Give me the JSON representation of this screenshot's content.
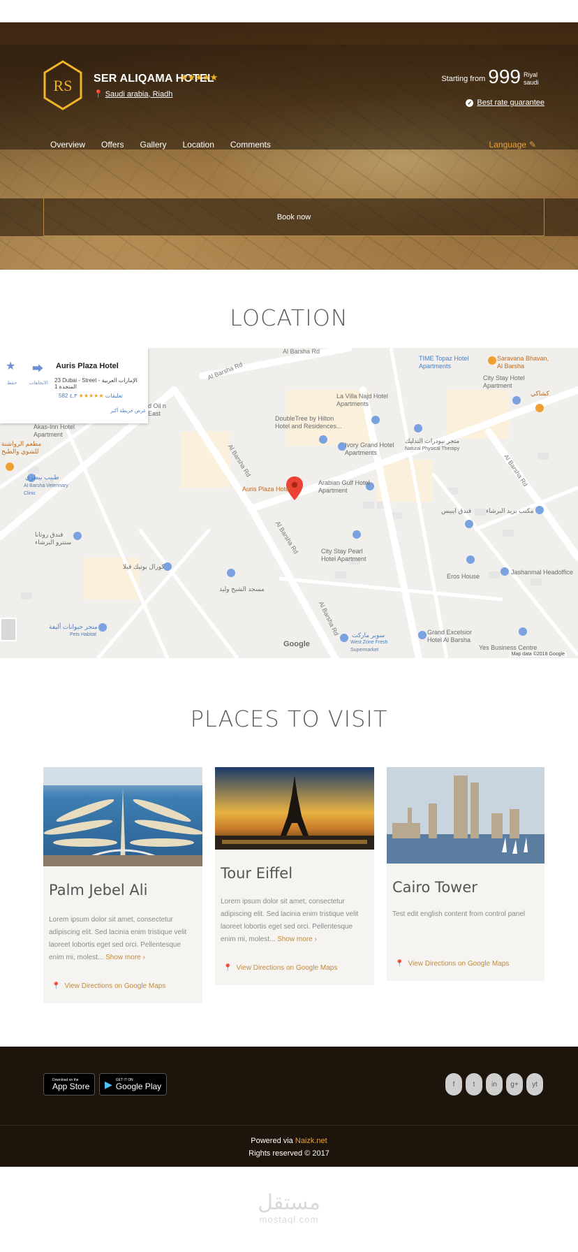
{
  "hero": {
    "hotel_name": "SER ALIQAMA HOTEL",
    "stars": "★★★★★",
    "location": "Saudi arabia, Riadh",
    "starting_label": "Starting from",
    "price": "999",
    "currency": "Riyal saudi",
    "guarantee": "Best rate guarantee",
    "nav": [
      "Overview",
      "Offers",
      "Gallery",
      "Location",
      "Comments"
    ],
    "language": "Language",
    "book": "Book now",
    "logo_text": "RS"
  },
  "location": {
    "title": "LOCATION",
    "card": {
      "name": "Auris Plaza Hotel",
      "address": "23 Dubai - Street - الإمارات العربية المتحدة 1",
      "rating": "٤,٣",
      "stars": "★★★★★",
      "reviews": "582 تعليقات",
      "bigger_map": "عرض خريطة أكبر",
      "save_label": "حفظ",
      "directions_label": "الاتجاهات"
    },
    "labels": {
      "barsha1": "Al Barsha Rd",
      "barsha2": "Al Barsha Rd",
      "barsha3": "Al Barsha Rd",
      "barsha4": "Al Barsha Rd",
      "barsha5": "Al Barsha Rd",
      "barsha6": "Al Barsha Rd",
      "auris": "Auris Plaza Hotel",
      "time_topaz": "TIME Topaz Hotel Apartments",
      "saravana": "Saravana Bhavan, Al Barsha",
      "city_stay": "City Stay Hotel Apartment",
      "villa": "La Villa Najd Hotel Apartments",
      "doubletree": "DoubleTree by Hilton Hotel and Residences...",
      "ivory": "Ivory Grand Hotel Apartments",
      "natural": "Natural Physical Therapy",
      "arabian": "Arabian Gulf Hotel Apartment",
      "oil": "d Oil n East",
      "akas": "Akas-Inn Hotel Apartment",
      "vet": "Al Barsha Veterinary Clinic",
      "city_pearl": "City Stay Pearl Hotel Apartment",
      "eros": "Eros House",
      "jashan": "Jashanmal Headoffice",
      "grand_excelsior": "Grand Excelsior Hotel Al Barsha",
      "yes": "Yes Business Centre",
      "west_zone": "West Zone Fresh Supermarket",
      "pets": "Pets Habitat",
      "ar1": "مطعم الرواشنة للشوي والطبخ",
      "ar2": "طبيب بيطري",
      "ar3": "فندق روتانا سنترو البرشاء",
      "ar4": "كورال بوتيك فيلا",
      "ar5": "مسجد الشيخ وليد",
      "ar6": "متجر حيوانات أليفة",
      "ar7": "فندق ايبيس",
      "ar8": "مكتب بريد البرشاء",
      "ar9": "كشاكي",
      "ar10": "سوبر ماركت",
      "ar11": "متجر نيودرات التدليك",
      "google": "Google",
      "footer": "Map data ©2018 Google"
    }
  },
  "places": {
    "title": "PLACES TO VISIT",
    "items": [
      {
        "title": "Palm Jebel Ali",
        "text": "Lorem ipsum dolor sit amet, consectetur adipiscing elit. Sed lacinia enim tristique velit laoreet lobortis eget sed orci. Pellentesque enim mi, molest...",
        "more": "Show more ›",
        "directions": "View Directions on Google Maps"
      },
      {
        "title": "Tour Eiffel",
        "text": "Lorem ipsum dolor sit amet, consectetur adipiscing elit. Sed lacinia enim tristique velit laoreet lobortis eget sed orci. Pellentesque enim mi, molest...",
        "more": "Show more ›",
        "directions": "View Directions on Google Maps"
      },
      {
        "title": "Cairo Tower",
        "text": "Test edit english content from control panel",
        "more": "",
        "directions": "View Directions on Google Maps"
      }
    ]
  },
  "footer": {
    "appstore_small": "Download on the",
    "appstore_big": "App Store",
    "googleplay_small": "GET IT ON",
    "googleplay_big": "Google Play",
    "social": [
      "f",
      "t",
      "in",
      "g+",
      "yt"
    ],
    "powered_prefix": "Powered via",
    "powered_brand": "Naizk.net",
    "rights": "Rights reserved © 2017"
  },
  "watermark": {
    "arabic": "مستقل",
    "latin": "mostaql.com"
  },
  "colors": {
    "accent": "#e8a43c",
    "footer_bg": "#1d140b",
    "card_bg": "#f6f4f1"
  }
}
